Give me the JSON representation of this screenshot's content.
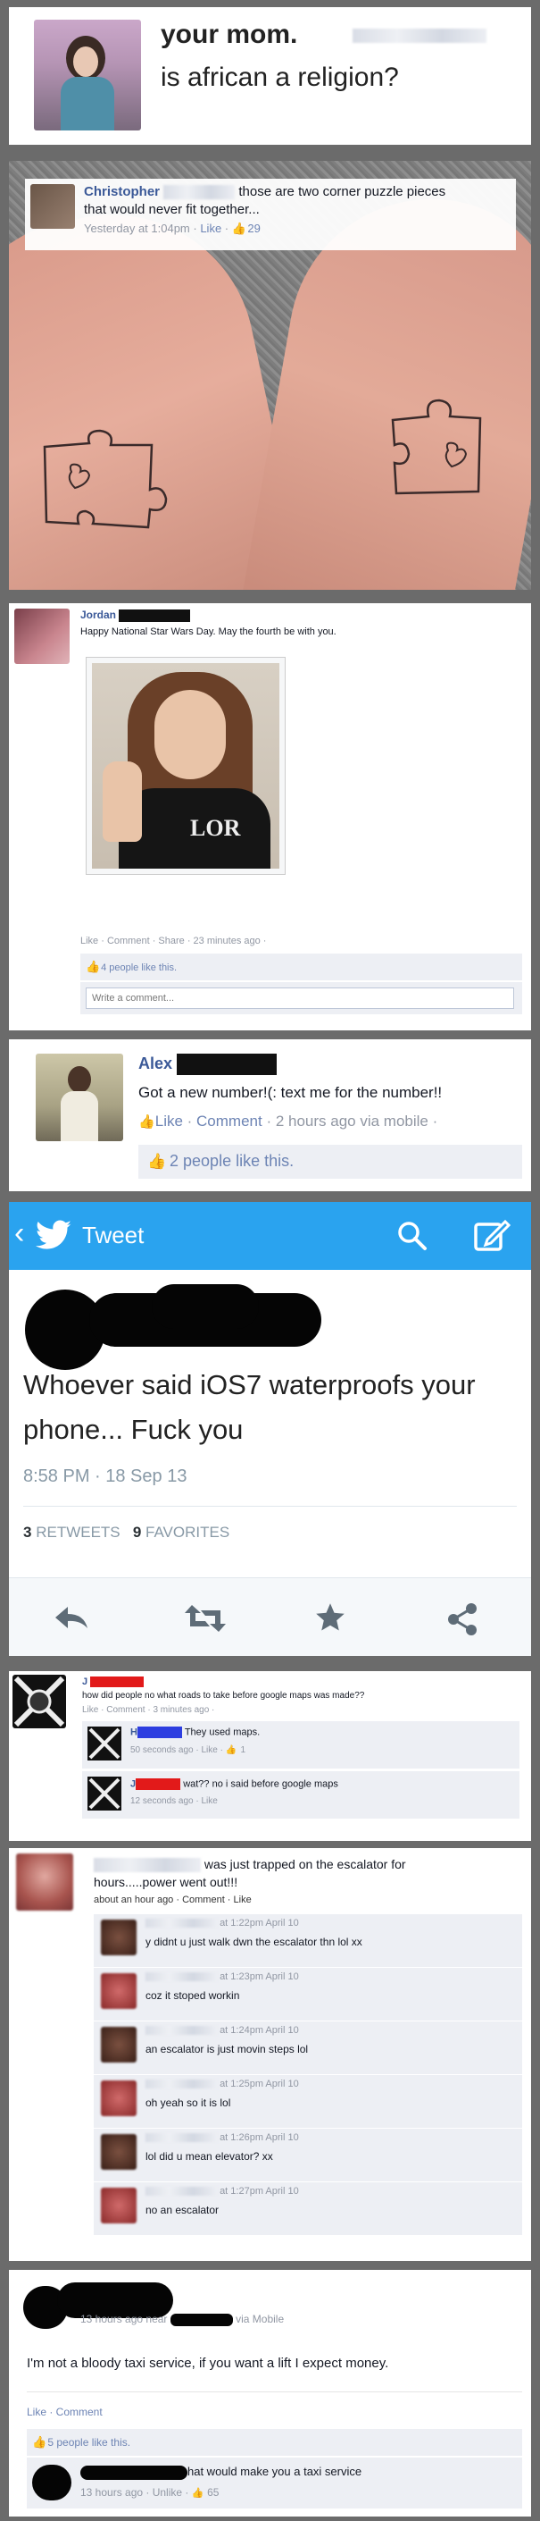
{
  "colors": {
    "fb_blue": "#3b5998",
    "tw_blue": "#2aa3ef",
    "redact_red": "#e21a1a"
  },
  "p1": {
    "brand": "your mom.",
    "status": "is african a religion?"
  },
  "p2": {
    "author": "Christopher",
    "text_line1": "those are two corner puzzle pieces",
    "text_line2": "that would never fit together...",
    "time": "Yesterday at 1:04pm",
    "like": "Like",
    "likes_count": "29",
    "icon": "thumbs-up-icon"
  },
  "p3": {
    "author": "Jordan",
    "text": "Happy National Star Wars Day. May the fourth be with you.",
    "shirt_text": "LOR",
    "actions": "Like · Comment · Share · 23 minutes ago ·",
    "likes": "4 people like this.",
    "comment_placeholder": "Write a comment..."
  },
  "p4": {
    "author": "Alex",
    "text": "Got a new number!(: text me for the number!!",
    "like": "Like",
    "comment": "Comment",
    "meta": "2 hours ago via mobile ·",
    "likes": "2 people like this."
  },
  "p5": {
    "header": "Tweet",
    "body": "Whoever said iOS7 waterproofs your phone... Fuck you",
    "time": "8:58 PM · 18 Sep 13",
    "retweets_num": "3",
    "retweets_label": "RETWEETS",
    "favorites_num": "9",
    "favorites_label": "FAVORITES"
  },
  "p6": {
    "author_initial": "J",
    "text": "how did people no what roads to take before google maps was made??",
    "meta": "Like · Comment · 3 minutes ago ·",
    "c1_initial": "H",
    "c1_text": "They used maps.",
    "c1_meta": "50 seconds ago · Like · ",
    "c1_likes": "1",
    "c2_initial": "J",
    "c2_text": "wat?? no i said before google maps",
    "c2_meta": "12 seconds ago · Like"
  },
  "p7": {
    "text_line1": "was just trapped on the escalator for",
    "text_line2": "hours.....power went out!!!",
    "meta": "about an hour ago · Comment · Like",
    "comments": [
      {
        "time": "at 1:22pm April 10",
        "text": "y didnt u just walk dwn the escalator thn lol xx"
      },
      {
        "time": "at 1:23pm April 10",
        "text": "coz it stoped workin"
      },
      {
        "time": "at 1:24pm April 10",
        "text": "an escalator is just movin steps lol"
      },
      {
        "time": "at 1:25pm April 10",
        "text": "oh yeah so it is lol"
      },
      {
        "time": "at 1:26pm April 10",
        "text": "lol did u mean elevator? xx"
      },
      {
        "time": "at 1:27pm April 10",
        "text": "no an escalator"
      }
    ]
  },
  "p8": {
    "meta_prefix": "13 hours ago near",
    "meta_suffix": "via Mobile",
    "text": "I'm not a bloody taxi service, if you want a lift I expect money.",
    "actions": "Like · Comment",
    "likes": "5 people like this.",
    "reply_text": "hat would make you a taxi service",
    "reply_meta": "13 hours ago · Unlike · ",
    "reply_likes": "65"
  }
}
